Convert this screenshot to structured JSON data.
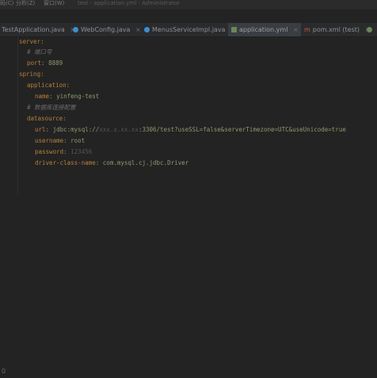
{
  "titlebar": {
    "menu_code": "码(C)",
    "menu_analyze": "分析(Z)",
    "menu_window": "窗口(W)",
    "title": "test - application.yml - Administrator"
  },
  "tabs": [
    {
      "label": "TestApplication.java",
      "icon_color": "#3c8fd0",
      "active": false
    },
    {
      "label": "WebConfig.java",
      "icon_color": "#3c8fd0",
      "active": false
    },
    {
      "label": "MenusServiceImpl.java",
      "icon_color": "#3c8fd0",
      "active": false
    },
    {
      "label": "application.yml",
      "icon_color": "#6a8759",
      "active": true
    },
    {
      "label": "pom.xml (test)",
      "icon_color": "#c06040",
      "active": false
    }
  ],
  "code": {
    "l1": {
      "key": "server:"
    },
    "l2": {
      "comment": "# 端口号"
    },
    "l3": {
      "key": "port:",
      "value": "8889"
    },
    "l4": {
      "key": "spring:"
    },
    "l5": {
      "key": "application:"
    },
    "l6": {
      "key": "name:",
      "value": "yinfeng-test"
    },
    "l7": {
      "comment": "# 数据库连接配置"
    },
    "l8": {
      "key": "datasource:"
    },
    "l9": {
      "key": "url:",
      "value_a": "jdbc:mysql://",
      "value_blur": "xxx.x.xx.xx",
      "value_b": ":3306/test?useSSL=false&serverTimezone=UTC&useUnicode=true"
    },
    "l10": {
      "key": "username:",
      "value": "root"
    },
    "l11": {
      "key": "password:",
      "value": "123456"
    },
    "l12": {
      "key": "driver-class-name:",
      "value": "com.mysql.cj.jdbc.Driver"
    }
  },
  "status": {
    "marker": "0"
  }
}
